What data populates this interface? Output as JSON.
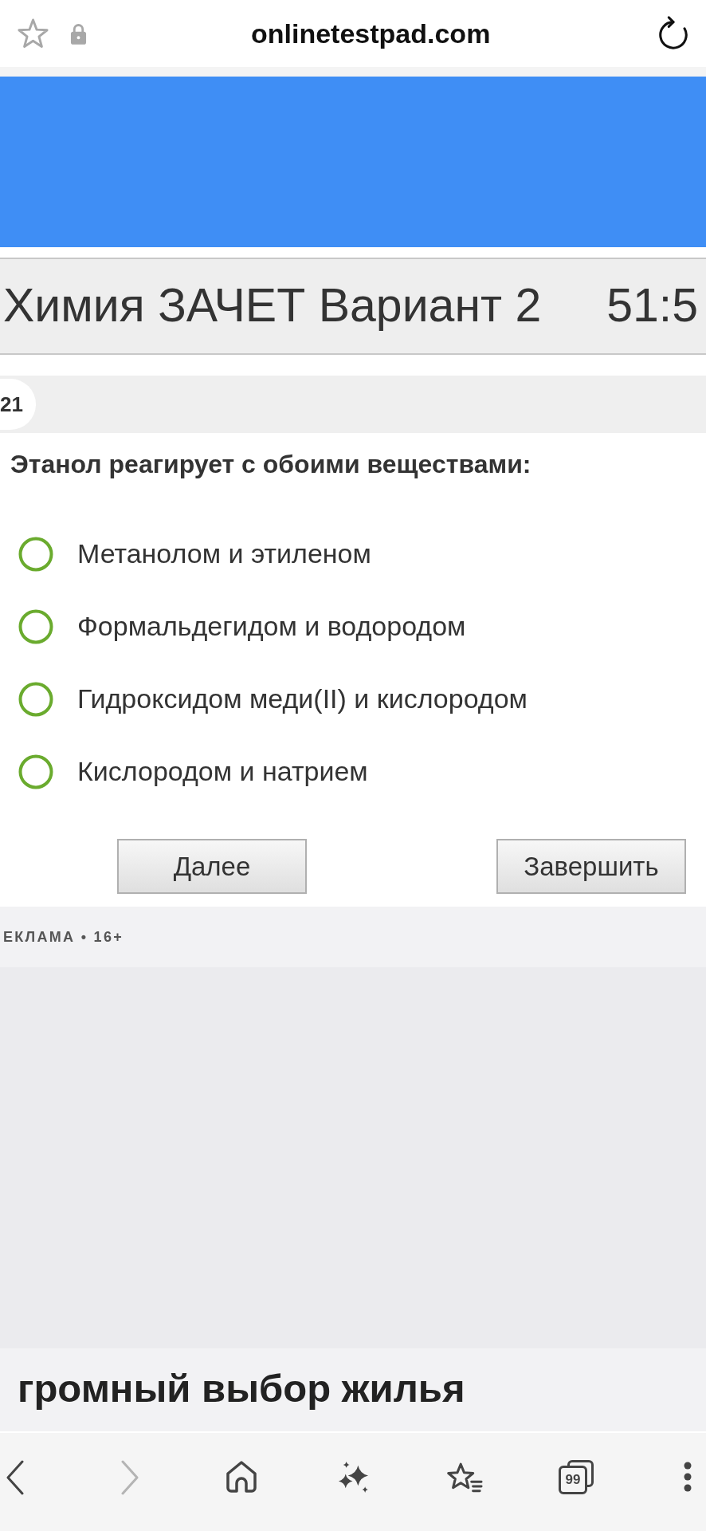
{
  "address_bar": {
    "url": "onlinetestpad.com"
  },
  "test": {
    "title": "Химия ЗАЧЕТ Вариант 2",
    "timer": "51:5"
  },
  "question": {
    "number": "21",
    "text": "Этанол реагирует с обоими веществами:",
    "options": [
      {
        "label": "Метанолом и этиленом",
        "selected": false
      },
      {
        "label": "Формальдегидом и водородом",
        "selected": false
      },
      {
        "label": "Гидроксидом меди(II) и кислородом",
        "selected": false
      },
      {
        "label": "Кислородом и натрием",
        "selected": false
      }
    ]
  },
  "buttons": [
    {
      "label": "Далее"
    },
    {
      "label": "Завершить"
    }
  ],
  "ad": {
    "label": "ЕКЛАМА • 16+",
    "heading": "громный выбор жилья"
  },
  "bottom_bar": {
    "items": [
      {
        "kind": "back",
        "disabled": false
      },
      {
        "kind": "forward",
        "disabled": true
      },
      {
        "kind": "home",
        "disabled": false
      },
      {
        "kind": "sparkle",
        "disabled": false
      },
      {
        "kind": "bookmarks",
        "disabled": false
      },
      {
        "kind": "tabs",
        "disabled": false,
        "count": "99"
      },
      {
        "kind": "more",
        "disabled": false
      }
    ]
  }
}
